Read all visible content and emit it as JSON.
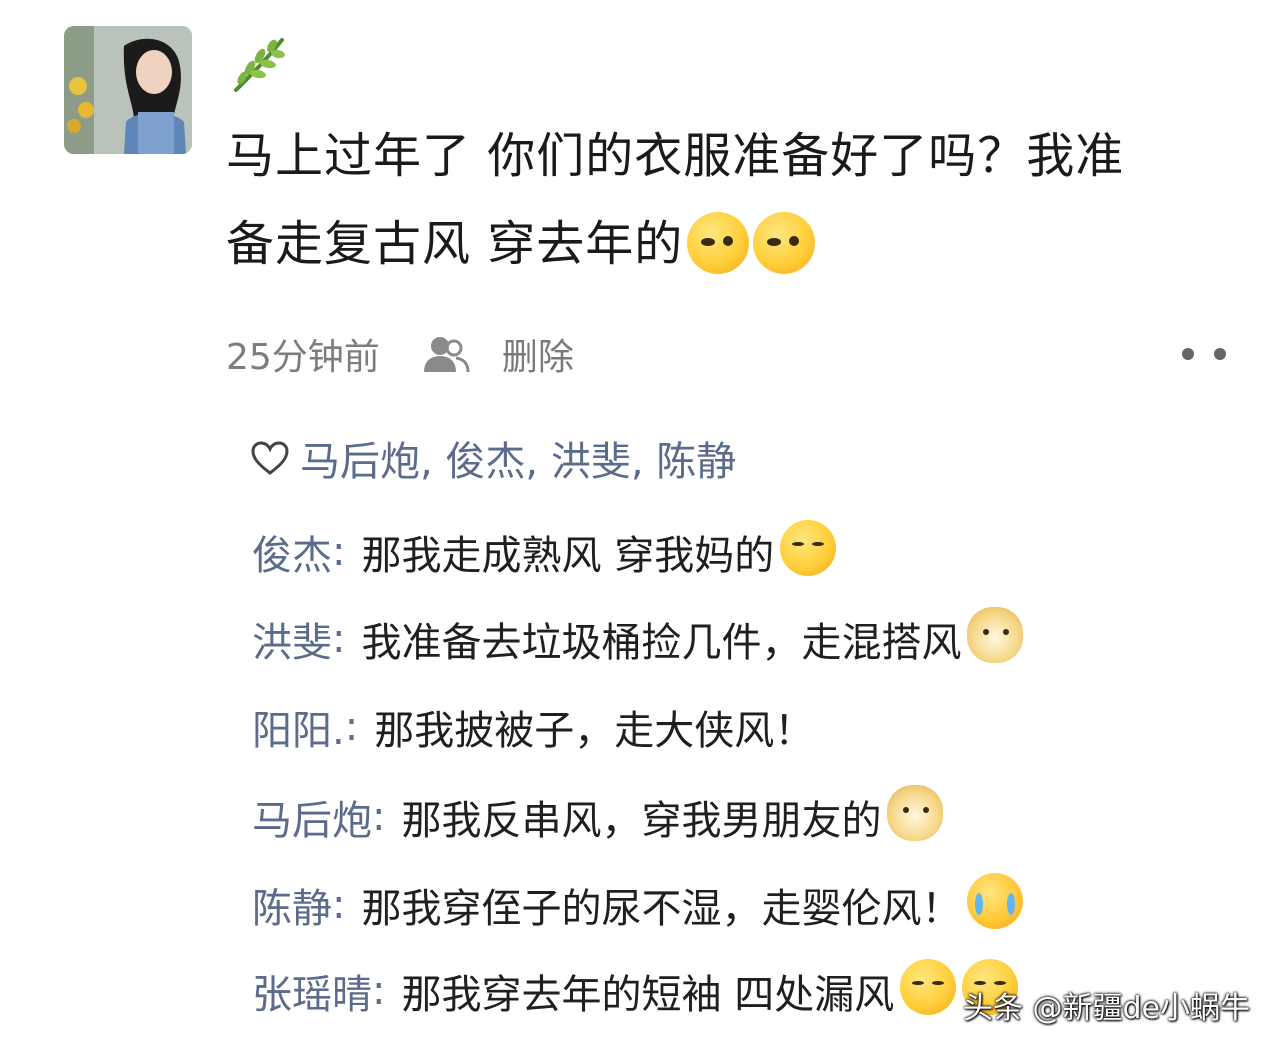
{
  "post": {
    "text_line1": "马上过年了 你们的衣服准备好了吗？我准",
    "text_line2": "备走复古风  穿去年的",
    "emoji": "salute-emoji"
  },
  "meta": {
    "time": "25分钟前",
    "delete": "删除",
    "person_icon": "person-icon",
    "more_icon": "more-dots-icon"
  },
  "likes": {
    "icon": "heart-icon",
    "names": "马后炮, 俊杰, 洪斐, 陈静"
  },
  "comments": [
    {
      "name": "俊杰",
      "text": "那我走成熟风 穿我妈的",
      "emoji": "sleepy-emoji"
    },
    {
      "name": "洪斐",
      "text": "我准备去垃圾桶捡几件，走混搭风",
      "emoji": "doge-emoji"
    },
    {
      "name": "阳阳.",
      "text": "那我披被子，走大侠风！",
      "emoji": ""
    },
    {
      "name": "马后炮",
      "text": "那我反串风，穿我男朋友的",
      "emoji": "doge-emoji"
    },
    {
      "name": "陈静",
      "text": "那我穿侄子的尿不湿，走婴伦风！",
      "emoji": "crying-emoji"
    },
    {
      "name": "张瑶晴",
      "text": "那我穿去年的短袖  四处漏风",
      "emoji": "cold-emoji"
    }
  ],
  "watermark": "头条 @新疆de小蜗牛"
}
